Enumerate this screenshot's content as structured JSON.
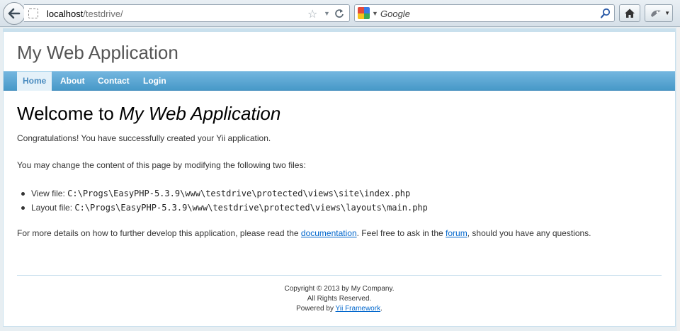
{
  "browser": {
    "url_host": "localhost",
    "url_path": "/testdrive/",
    "search_placeholder": "Google"
  },
  "icons": {
    "back": "back-arrow-icon",
    "site_identity": "site-identity-icon",
    "bookmark": "star-icon",
    "reload": "reload-icon",
    "search_engine": "google-icon",
    "search_go": "magnifier-icon",
    "home": "home-icon",
    "addon": "addon-icon"
  },
  "app": {
    "logo": "My Web Application",
    "menu": [
      "Home",
      "About",
      "Contact",
      "Login"
    ],
    "active_menu": "Home"
  },
  "content": {
    "heading_prefix": "Welcome to ",
    "heading_app": "My Web Application",
    "congrats": "Congratulations! You have successfully created your Yii application.",
    "change_intro": "You may change the content of this page by modifying the following two files:",
    "files": [
      {
        "label": "View file: ",
        "path": "C:\\Progs\\EasyPHP-5.3.9\\www\\testdrive\\protected\\views\\site\\index.php"
      },
      {
        "label": "Layout file: ",
        "path": "C:\\Progs\\EasyPHP-5.3.9\\www\\testdrive\\protected\\views\\layouts\\main.php"
      }
    ],
    "details_before": "For more details on how to further develop this application, please read the ",
    "details_link_docs": "documentation",
    "details_middle": ". Feel free to ask in the ",
    "details_link_forum": "forum",
    "details_after": ", should you have any questions."
  },
  "footer": {
    "copyright": "Copyright © 2013 by My Company.",
    "rights": "All Rights Reserved.",
    "powered_prefix": "Powered by ",
    "powered_link": "Yii Framework",
    "powered_suffix": "."
  },
  "colors": {
    "menu_gradient_top": "#74b6df",
    "menu_gradient_bottom": "#4799c8",
    "active_menu_bg": "#e4f1f9",
    "link": "#0066cc"
  }
}
